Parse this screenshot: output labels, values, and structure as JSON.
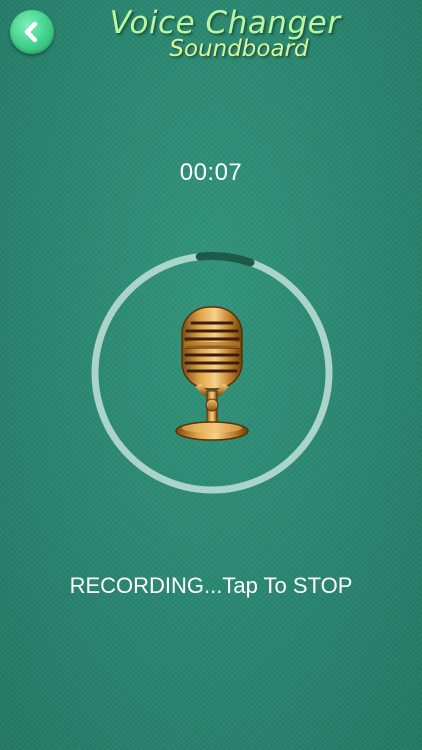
{
  "header": {
    "back_icon": "chevron-left-icon",
    "title": "Voice Changer",
    "subtitle": "Soundboard",
    "back_button_color": "#3fcf8a"
  },
  "recorder": {
    "elapsed_time": "00:07",
    "progress_fraction": 0.07,
    "mic_icon": "microphone-icon",
    "ring_color": "#b9ddd2",
    "progress_color": "#1f5a48",
    "status": "RECORDING...Tap To STOP"
  }
}
